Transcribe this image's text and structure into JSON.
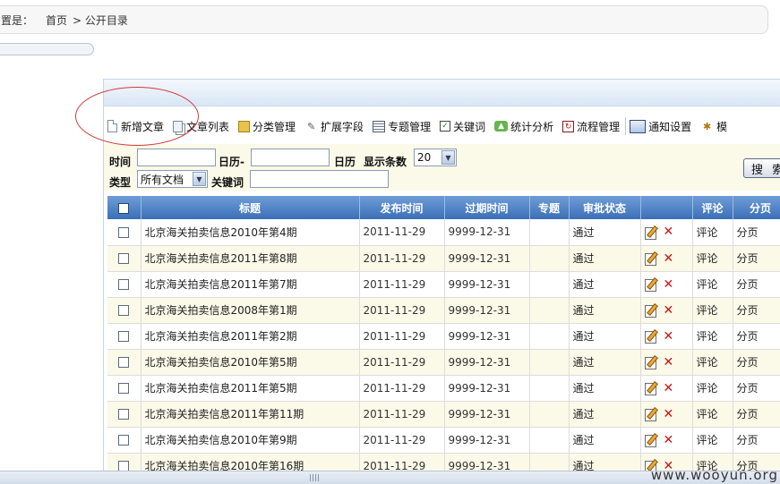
{
  "breadcrumb": {
    "prefix": "置是：",
    "home": "首页",
    "current": "> 公开目录"
  },
  "toolbar": {
    "items": [
      {
        "label": "新增文章",
        "icon": "new-document-icon"
      },
      {
        "label": "文章列表",
        "icon": "document-list-icon"
      },
      {
        "label": "分类管理",
        "icon": "category-icon"
      },
      {
        "label": "扩展字段",
        "icon": "extend-field-icon"
      },
      {
        "label": "专题管理",
        "icon": "topic-icon"
      },
      {
        "label": "关键词",
        "icon": "keyword-icon"
      },
      {
        "label": "统计分析",
        "icon": "statistics-icon"
      },
      {
        "label": "流程管理",
        "icon": "workflow-icon"
      },
      {
        "label": "通知设置",
        "icon": "notice-settings-icon"
      },
      {
        "label": "模",
        "icon": "template-icon"
      }
    ]
  },
  "filter": {
    "time_label": "时间",
    "calendar_dash": "日历-",
    "calendar_label": "日历",
    "show_count_label": "显示条数",
    "show_count_value": "20",
    "type_label": "类型",
    "type_value": "所有文档",
    "keyword_label": "关键词",
    "search_button": "搜 索"
  },
  "table": {
    "headers": [
      "标题",
      "发布时间",
      "过期时间",
      "专题",
      "审批状态",
      "",
      "评论",
      "分页"
    ],
    "rows": [
      {
        "title": "北京海关拍卖信息2010年第4期",
        "publish": "2011-11-29",
        "expire": "9999-12-31",
        "topic": "",
        "status": "通过",
        "comment": "评论",
        "page": "分页"
      },
      {
        "title": "北京海关拍卖信息2011年第8期",
        "publish": "2011-11-29",
        "expire": "9999-12-31",
        "topic": "",
        "status": "通过",
        "comment": "评论",
        "page": "分页"
      },
      {
        "title": "北京海关拍卖信息2011年第7期",
        "publish": "2011-11-29",
        "expire": "9999-12-31",
        "topic": "",
        "status": "通过",
        "comment": "评论",
        "page": "分页"
      },
      {
        "title": "北京海关拍卖信息2008年第1期",
        "publish": "2011-11-29",
        "expire": "9999-12-31",
        "topic": "",
        "status": "通过",
        "comment": "评论",
        "page": "分页"
      },
      {
        "title": "北京海关拍卖信息2011年第2期",
        "publish": "2011-11-29",
        "expire": "9999-12-31",
        "topic": "",
        "status": "通过",
        "comment": "评论",
        "page": "分页"
      },
      {
        "title": "北京海关拍卖信息2010年第5期",
        "publish": "2011-11-29",
        "expire": "9999-12-31",
        "topic": "",
        "status": "通过",
        "comment": "评论",
        "page": "分页"
      },
      {
        "title": "北京海关拍卖信息2011年第5期",
        "publish": "2011-11-29",
        "expire": "9999-12-31",
        "topic": "",
        "status": "通过",
        "comment": "评论",
        "page": "分页"
      },
      {
        "title": "北京海关拍卖信息2011年第11期",
        "publish": "2011-11-29",
        "expire": "9999-12-31",
        "topic": "",
        "status": "通过",
        "comment": "评论",
        "page": "分页"
      },
      {
        "title": "北京海关拍卖信息2010年第9期",
        "publish": "2011-11-29",
        "expire": "9999-12-31",
        "topic": "",
        "status": "通过",
        "comment": "评论",
        "page": "分页"
      },
      {
        "title": "北京海关拍卖信息2010年第16期",
        "publish": "2011-11-29",
        "expire": "9999-12-31",
        "topic": "",
        "status": "通过",
        "comment": "评论",
        "page": "分页"
      }
    ]
  },
  "watermark": "www.wooyun.org",
  "colors": {
    "header_blue": "#3a6fb8",
    "row_alt": "#fbf9e8",
    "delete_red": "#d21212",
    "annotation_red": "#d23b3b"
  }
}
